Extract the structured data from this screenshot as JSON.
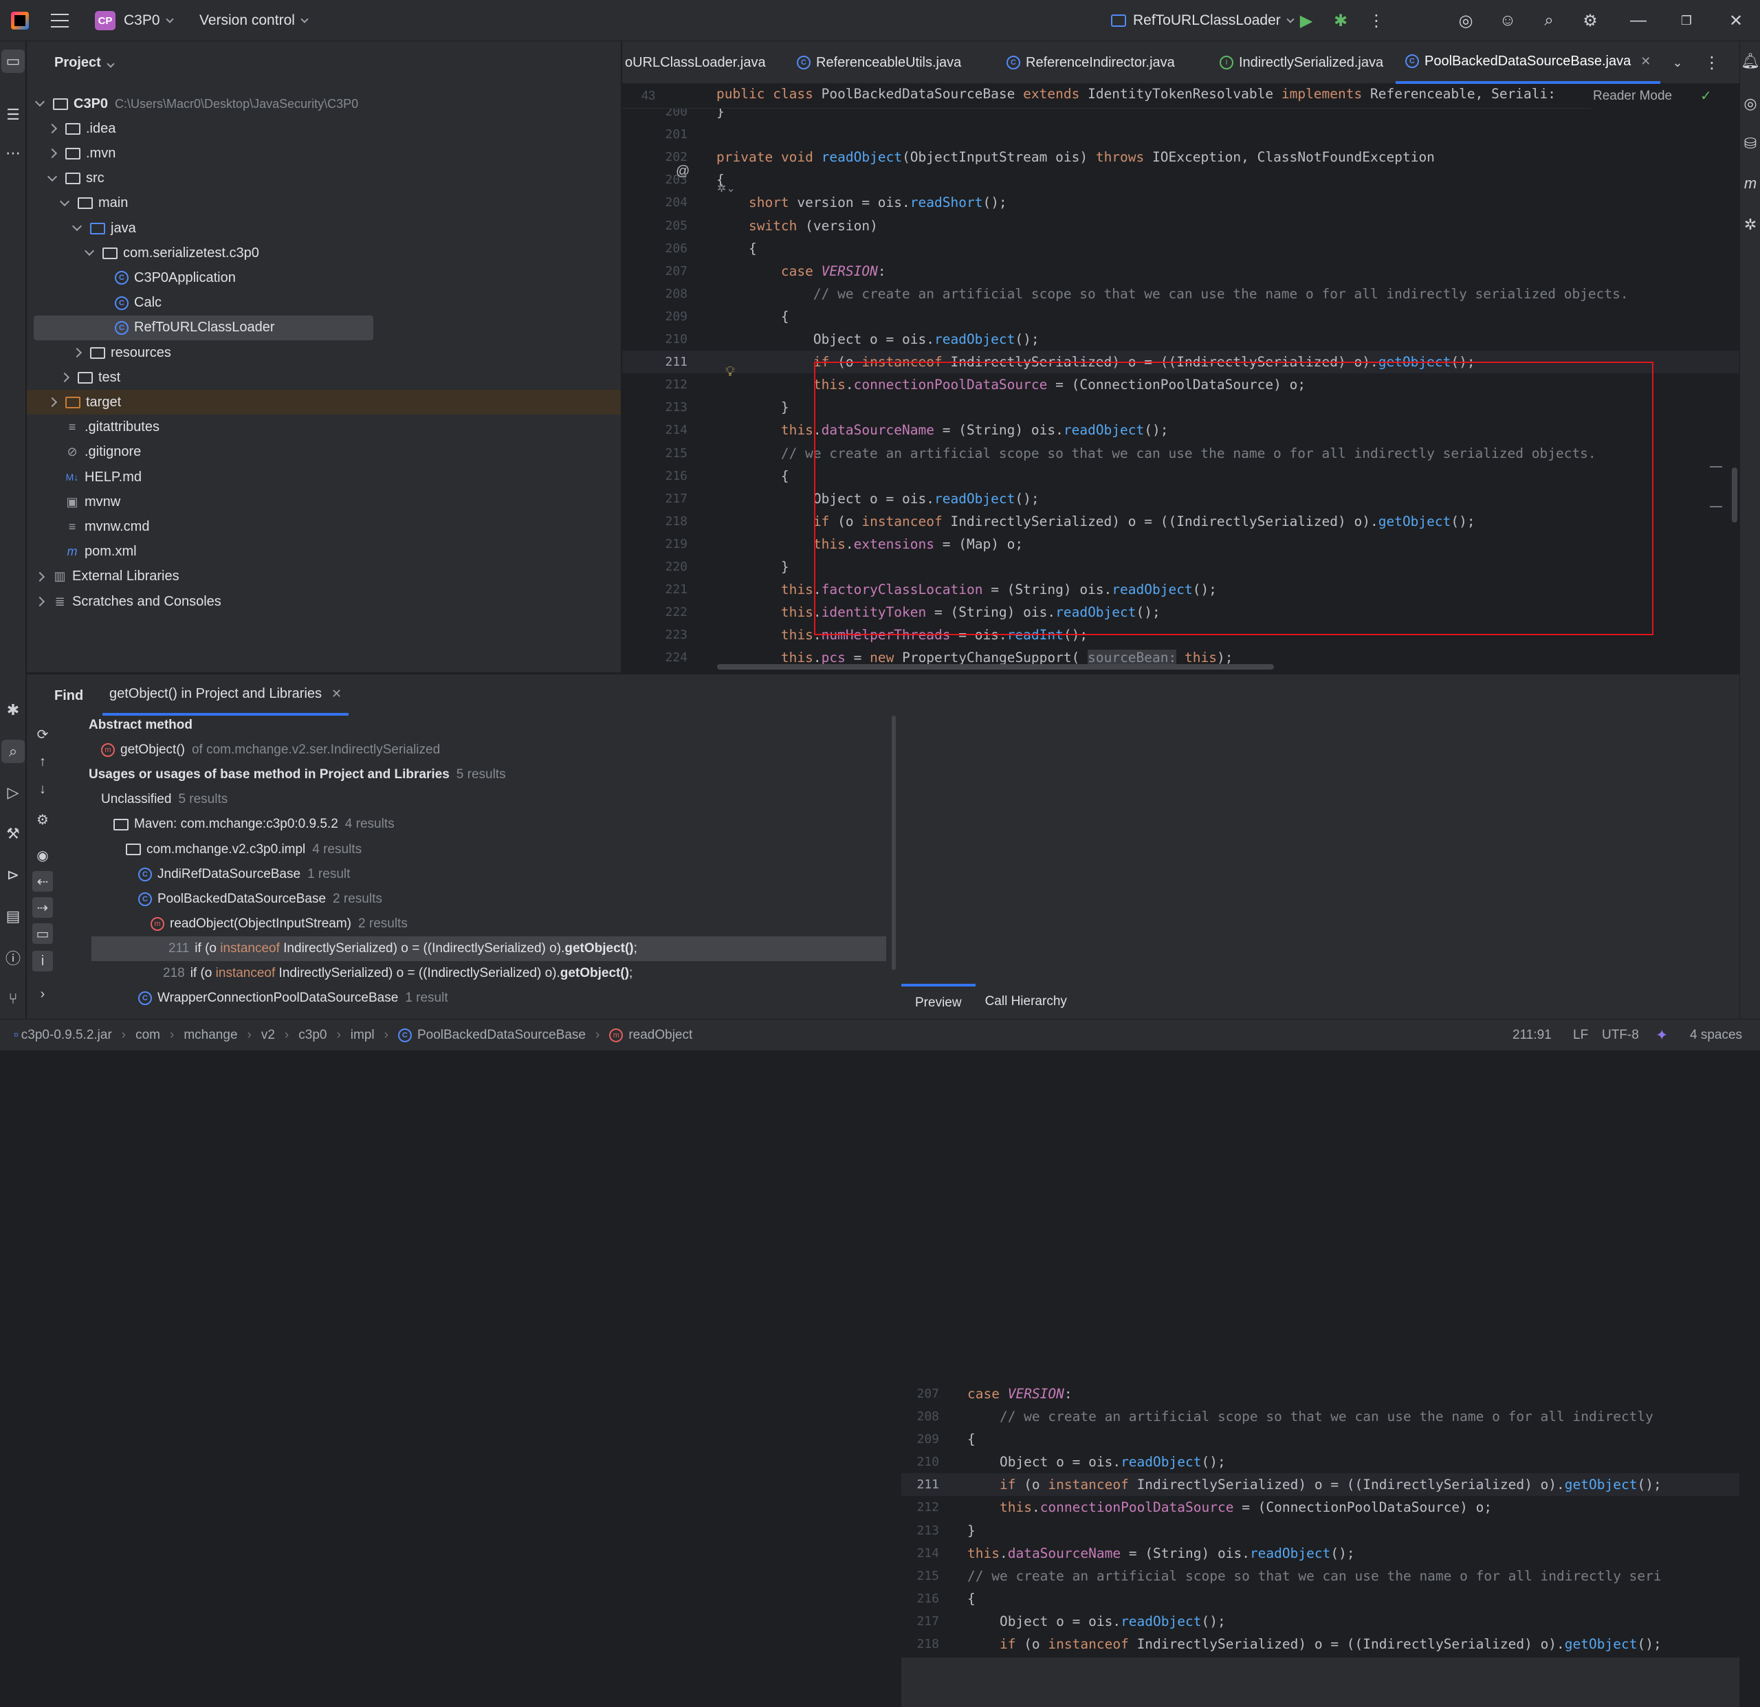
{
  "titlebar": {
    "project_badge": "CP",
    "project_name": "C3P0",
    "vcs": "Version control",
    "run_config": "RefToURLClassLoader"
  },
  "project_panel": {
    "title": "Project",
    "tree": [
      {
        "label": "C3P0",
        "extra": "C:\\Users\\Macr0\\Desktop\\JavaSecurity\\C3P0",
        "depth": 0,
        "arrow": "down",
        "icon": "module"
      },
      {
        "label": ".idea",
        "depth": 1,
        "arrow": "right",
        "icon": "folder"
      },
      {
        "label": ".mvn",
        "depth": 1,
        "arrow": "right",
        "icon": "folder"
      },
      {
        "label": "src",
        "depth": 1,
        "arrow": "down",
        "icon": "folder"
      },
      {
        "label": "main",
        "depth": 2,
        "arrow": "down",
        "icon": "folder"
      },
      {
        "label": "java",
        "depth": 3,
        "arrow": "down",
        "icon": "folder-blue"
      },
      {
        "label": "com.serializetest.c3p0",
        "depth": 4,
        "arrow": "down",
        "icon": "package"
      },
      {
        "label": "C3P0Application",
        "depth": 5,
        "arrow": "none",
        "icon": "class"
      },
      {
        "label": "Calc",
        "depth": 5,
        "arrow": "none",
        "icon": "class"
      },
      {
        "label": "RefToURLClassLoader",
        "depth": 5,
        "arrow": "none",
        "icon": "class",
        "selected": true
      },
      {
        "label": "resources",
        "depth": 3,
        "arrow": "right",
        "icon": "folder"
      },
      {
        "label": "test",
        "depth": 2,
        "arrow": "right",
        "icon": "folder"
      },
      {
        "label": "target",
        "depth": 1,
        "arrow": "right",
        "icon": "folder-orange",
        "excluded": true
      },
      {
        "label": ".gitattributes",
        "depth": 1,
        "arrow": "none",
        "icon": "text"
      },
      {
        "label": ".gitignore",
        "depth": 1,
        "arrow": "none",
        "icon": "ignore"
      },
      {
        "label": "HELP.md",
        "depth": 1,
        "arrow": "none",
        "icon": "md"
      },
      {
        "label": "mvnw",
        "depth": 1,
        "arrow": "none",
        "icon": "terminal"
      },
      {
        "label": "mvnw.cmd",
        "depth": 1,
        "arrow": "none",
        "icon": "text"
      },
      {
        "label": "pom.xml",
        "depth": 1,
        "arrow": "none",
        "icon": "maven"
      },
      {
        "label": "External Libraries",
        "depth": 0,
        "arrow": "right",
        "icon": "libs"
      },
      {
        "label": "Scratches and Consoles",
        "depth": 0,
        "arrow": "right",
        "icon": "scratch"
      }
    ]
  },
  "editor": {
    "tabs": [
      {
        "label": "oURLClassLoader.java",
        "icon": "none"
      },
      {
        "label": "ReferenceableUtils.java",
        "icon": "class"
      },
      {
        "label": "ReferenceIndirector.java",
        "icon": "class"
      },
      {
        "label": "IndirectlySerialized.java",
        "icon": "interface"
      },
      {
        "label": "PoolBackedDataSourceBase.java",
        "icon": "class",
        "active": true
      }
    ],
    "reader_mode": "Reader Mode",
    "sticky_line_number": "43",
    "sticky_header": "public class PoolBackedDataSourceBase extends IdentityTokenResolvable implements Referenceable, Seriali:",
    "lines": [
      {
        "n": "200",
        "code": "}"
      },
      {
        "n": "201",
        "code": ""
      },
      {
        "n": "202",
        "code": "private void readObject(ObjectInputStream ois) throws IOException, ClassNotFoundException"
      },
      {
        "n": "203",
        "code": "{"
      },
      {
        "n": "204",
        "code": "    short version = ois.readShort();"
      },
      {
        "n": "205",
        "code": "    switch (version)"
      },
      {
        "n": "206",
        "code": "    {"
      },
      {
        "n": "207",
        "code": "        case VERSION:"
      },
      {
        "n": "208",
        "code": "            // we create an artificial scope so that we can use the name o for all indirectly serialized objects."
      },
      {
        "n": "209",
        "code": "        {"
      },
      {
        "n": "210",
        "code": "            Object o = ois.readObject();"
      },
      {
        "n": "211",
        "code": "            if (o instanceof IndirectlySerialized) o = ((IndirectlySerialized) o).getObject();"
      },
      {
        "n": "212",
        "code": "            this.connectionPoolDataSource = (ConnectionPoolDataSource) o;"
      },
      {
        "n": "213",
        "code": "        }"
      },
      {
        "n": "214",
        "code": "        this.dataSourceName = (String) ois.readObject();"
      },
      {
        "n": "215",
        "code": "        // we create an artificial scope so that we can use the name o for all indirectly serialized objects."
      },
      {
        "n": "216",
        "code": "        {"
      },
      {
        "n": "217",
        "code": "            Object o = ois.readObject();"
      },
      {
        "n": "218",
        "code": "            if (o instanceof IndirectlySerialized) o = ((IndirectlySerialized) o).getObject();"
      },
      {
        "n": "219",
        "code": "            this.extensions = (Map) o;"
      },
      {
        "n": "220",
        "code": "        }"
      },
      {
        "n": "221",
        "code": "        this.factoryClassLocation = (String) ois.readObject();"
      },
      {
        "n": "222",
        "code": "        this.identityToken = (String) ois.readObject();"
      },
      {
        "n": "223",
        "code": "        this.numHelperThreads = ois.readInt();"
      },
      {
        "n": "224",
        "code": "        this.pcs = new PropertyChangeSupport( sourceBean: this);"
      }
    ]
  },
  "find": {
    "title": "Find",
    "tab_label": "getObject() in Project and Libraries",
    "rows": [
      {
        "label": "Abstract method",
        "bold": true,
        "depth": 0,
        "arrow": "down"
      },
      {
        "label": "getObject()",
        "extra": "of com.mchange.v2.ser.IndirectlySerialized",
        "depth": 1,
        "arrow": "none",
        "icon": "method"
      },
      {
        "label": "Usages or usages of base method in Project and Libraries",
        "extra": "5 results",
        "bold": true,
        "depth": 0,
        "arrow": "down"
      },
      {
        "label": "Unclassified",
        "extra": "5 results",
        "depth": 1,
        "arrow": "down"
      },
      {
        "label": "Maven: com.mchange:c3p0:0.9.5.2",
        "extra": "4 results",
        "depth": 2,
        "arrow": "down",
        "icon": "lib"
      },
      {
        "label": "com.mchange.v2.c3p0.impl",
        "extra": "4 results",
        "depth": 3,
        "arrow": "down",
        "icon": "package"
      },
      {
        "label": "JndiRefDataSourceBase",
        "extra": "1 result",
        "depth": 4,
        "arrow": "right",
        "icon": "class"
      },
      {
        "label": "PoolBackedDataSourceBase",
        "extra": "2 results",
        "depth": 4,
        "arrow": "down",
        "icon": "class"
      },
      {
        "label": "readObject(ObjectInputStream)",
        "extra": "2 results",
        "depth": 5,
        "arrow": "down",
        "icon": "method"
      },
      {
        "num": "211",
        "label": "if (o instanceof IndirectlySerialized) o = ((IndirectlySerialized) o).getObject();",
        "depth": 6,
        "selected": true
      },
      {
        "num": "218",
        "label": "if (o instanceof IndirectlySerialized) o = ((IndirectlySerialized) o).getObject();",
        "depth": 6
      },
      {
        "label": "WrapperConnectionPoolDataSourceBase",
        "extra": "1 result",
        "depth": 4,
        "arrow": "right",
        "icon": "class"
      }
    ],
    "preview_lines": [
      {
        "n": "207",
        "code": "case VERSION:"
      },
      {
        "n": "208",
        "code": "    // we create an artificial scope so that we can use the name o for all indirectly"
      },
      {
        "n": "209",
        "code": "{"
      },
      {
        "n": "210",
        "code": "    Object o = ois.readObject();"
      },
      {
        "n": "211",
        "code": "    if (o instanceof IndirectlySerialized) o = ((IndirectlySerialized) o).getObject();"
      },
      {
        "n": "212",
        "code": "    this.connectionPoolDataSource = (ConnectionPoolDataSource) o;"
      },
      {
        "n": "213",
        "code": "}"
      },
      {
        "n": "214",
        "code": "this.dataSourceName = (String) ois.readObject();"
      },
      {
        "n": "215",
        "code": "// we create an artificial scope so that we can use the name o for all indirectly seri"
      },
      {
        "n": "216",
        "code": "{"
      },
      {
        "n": "217",
        "code": "    Object o = ois.readObject();"
      },
      {
        "n": "218",
        "code": "    if (o instanceof IndirectlySerialized) o = ((IndirectlySerialized) o).getObject();"
      }
    ],
    "preview_tabs": [
      "Preview",
      "Call Hierarchy"
    ]
  },
  "statusbar": {
    "breadcrumbs": [
      "c3p0-0.9.5.2.jar",
      "com",
      "mchange",
      "v2",
      "c3p0",
      "impl",
      "PoolBackedDataSourceBase",
      "readObject"
    ],
    "position": "211:91",
    "line_sep": "LF",
    "encoding": "UTF-8",
    "indent": "4 spaces"
  },
  "colors": {
    "accent": "#3574f0",
    "highlight_box": "#e0161b",
    "keyword": "#cf8e6d",
    "method": "#56a8f5",
    "field": "#c77dbb"
  }
}
